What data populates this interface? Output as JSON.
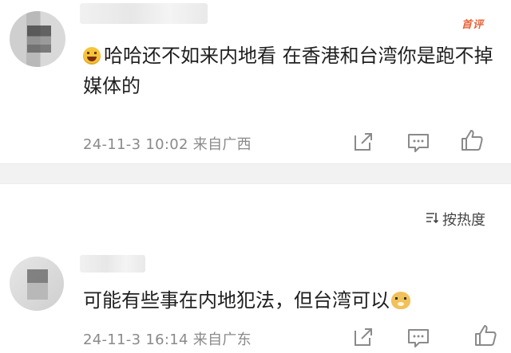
{
  "comments": [
    {
      "badge": "首评",
      "text": "哈哈还不如来内地看 在香港和台湾你是跑不掉媒体的",
      "emoji_icon": "laughing-emoji-icon",
      "date": "24-11-3 10:02",
      "location": "来自广西"
    },
    {
      "text": "可能有些事在内地犯法，但台湾可以",
      "emoji_icon": "doge-emoji-icon",
      "date": "24-11-3 16:14",
      "location": "来自广东"
    }
  ],
  "sort": {
    "label": "按热度",
    "icon": "sort-icon"
  },
  "actions": [
    "share-icon",
    "comment-icon",
    "like-icon"
  ],
  "colors": {
    "badge": "#e8643a",
    "meta": "#8a8a8a",
    "divider": "#f2f2f2"
  }
}
